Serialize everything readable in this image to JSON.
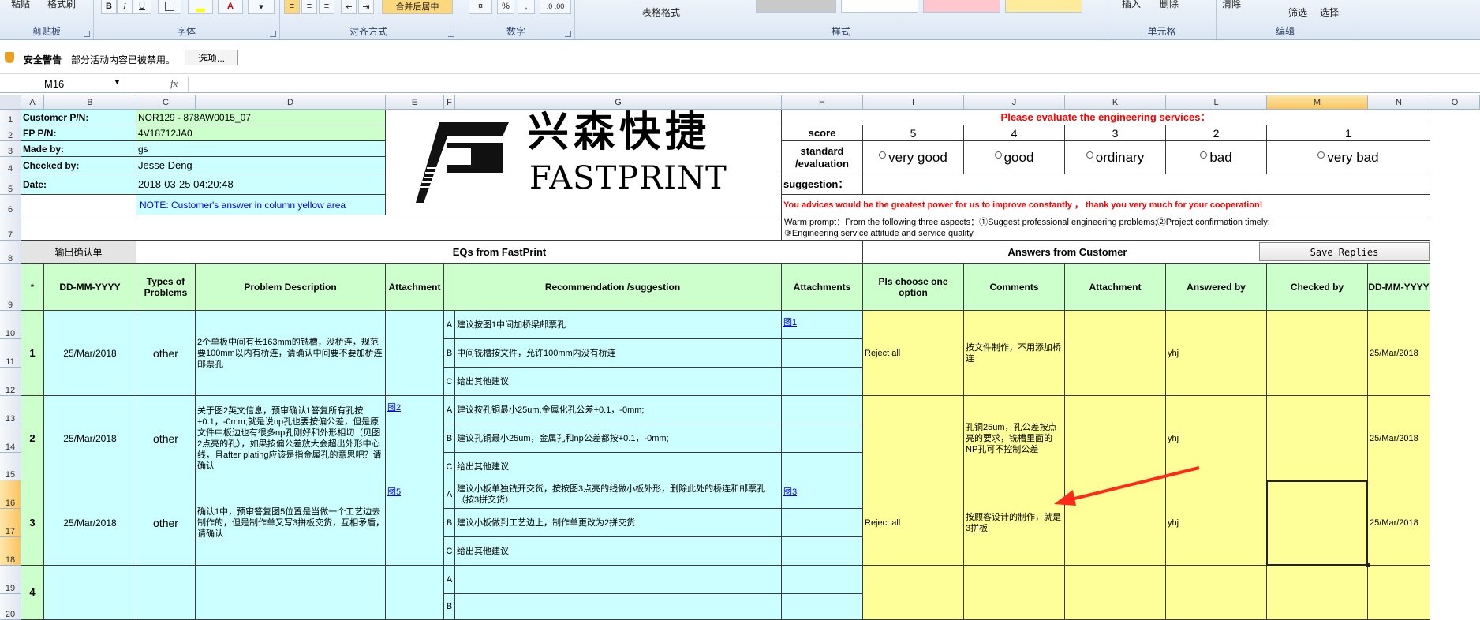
{
  "ribbon": {
    "groups": [
      {
        "label": "剪贴板",
        "btns": [
          "粘贴",
          "格式刷"
        ]
      },
      {
        "label": "字体",
        "btns": [
          "B",
          "I",
          "U",
          "A"
        ]
      },
      {
        "label": "对齐方式",
        "btns": [
          "合并后居中"
        ]
      },
      {
        "label": "数字",
        "btns": [
          "%",
          ","
        ]
      },
      {
        "label": "样式",
        "btns": [
          "表格格式"
        ]
      },
      {
        "label": "单元格",
        "btns": [
          "插入",
          "删除"
        ]
      },
      {
        "label": "编辑",
        "btns": [
          "清除",
          "筛选",
          "选择"
        ]
      }
    ]
  },
  "security": {
    "title": "安全警告",
    "message": "部分活动内容已被禁用。",
    "options_button": "选项..."
  },
  "formula_bar": {
    "name_box": "M16",
    "fx": "fx",
    "content": ""
  },
  "columns": [
    "A",
    "B",
    "C",
    "D",
    "E",
    "F",
    "G",
    "H",
    "I",
    "J",
    "K",
    "L",
    "M",
    "N",
    "O"
  ],
  "rows": [
    "1",
    "2",
    "3",
    "4",
    "5",
    "6",
    "7",
    "8",
    "9",
    "10",
    "11",
    "12",
    "13",
    "14",
    "15",
    "16",
    "17",
    "18",
    "19",
    "20"
  ],
  "header_info": {
    "customer_pn_label": "Customer P/N:",
    "customer_pn": "NOR129 - 878AW0015_07",
    "fp_pn_label": "FP P/N:",
    "fp_pn": "4V18712JA0",
    "made_by_label": "Made by:",
    "made_by": "gs",
    "checked_by_label": "Checked by:",
    "checked_by": "Jesse Deng",
    "date_label": "Date:",
    "date": "2018-03-25 04:20:48",
    "note": "NOTE: Customer's  answer in column yellow area"
  },
  "logo": {
    "cn": "兴森快捷",
    "en": "FASTPRINT"
  },
  "evaluation": {
    "title": "Please evaluate the engineering services：",
    "score_label": "score",
    "scores": [
      "5",
      "4",
      "3",
      "2",
      "1"
    ],
    "standard_label_1": "standard",
    "standard_label_2": "/evaluation",
    "options": [
      "very good",
      "good",
      "ordinary",
      "bad",
      "very bad"
    ],
    "suggestion_label": "suggestion：",
    "advice": "You advices would be the greatest power for us to improve constantly ，  thank you very much for your cooperation!",
    "warm_prompt_1": "Warm prompt：From the following three aspects：①Suggest professional engineering problems;②Project confirmation timely;",
    "warm_prompt_2": "③Engineering service attitude and service quality"
  },
  "sections": {
    "output_confirm": "输出确认单",
    "eqs_title": "EQs from FastPrint",
    "answers_title": "Answers from Customer",
    "save_replies": "Save Replies"
  },
  "table_headers": {
    "star": "*",
    "date": "DD-MM-YYYY",
    "types": "Types of Problems",
    "problem": "Problem Description",
    "attachment": "Attachment",
    "recommendation": "Recommendation /suggestion",
    "attachments": "Attachments",
    "choose": "Pls choose one option",
    "comments": "Comments",
    "cust_attachment": "Attachment",
    "answered_by": "Answered by",
    "checked_by": "Checked by",
    "cust_date": "DD-MM-YYYY"
  },
  "eqs": [
    {
      "no": "1",
      "date": "25/Mar/2018",
      "type": "other",
      "problem": "2个单板中间有长163mm的铣槽，没桥连，规范要100mm以内有桥连，请确认中间要不要加桥连邮票孔",
      "attachment": "",
      "options": [
        {
          "letter": "A",
          "text": "建议按图1中间加桥梁邮票孔",
          "att": "图1"
        },
        {
          "letter": "B",
          "text": "中间铣槽按文件，允许100mm内没有桥连",
          "att": ""
        },
        {
          "letter": "C",
          "text": "给出其他建议",
          "att": ""
        }
      ],
      "choice": "Reject all",
      "comment": "按文件制作，不用添加桥连",
      "answered_by": "yhj",
      "checked_by": "",
      "cdate": "25/Mar/2018"
    },
    {
      "no": "2",
      "date": "25/Mar/2018",
      "type": "other",
      "problem": "关于图2英文信息，预审确认1答复所有孔按+0.1，-0mm;就是说np孔也要按偏公差，但是原文件中板边也有很多np孔刚好和外形相切（见图2点亮的孔），如果按偏公差放大会超出外形中心线，且after plating应该是指金属孔的意思吧？请确认",
      "attachment": "图2",
      "options": [
        {
          "letter": "A",
          "text": "建议按孔铜最小25um,金属化孔公差+0.1，-0mm;",
          "att": ""
        },
        {
          "letter": "B",
          "text": "建议孔铜最小25um，金属孔和np公差都按+0.1，-0mm;",
          "att": ""
        },
        {
          "letter": "C",
          "text": "给出其他建议",
          "att": ""
        }
      ],
      "choice": "",
      "comment": "孔铜25um，孔公差按点亮的要求，铣槽里面的NP孔可不控制公差",
      "answered_by": "yhj",
      "checked_by": "",
      "cdate": "25/Mar/2018"
    },
    {
      "no": "3",
      "date": "25/Mar/2018",
      "type": "other",
      "problem": "确认1中，预审答复图5位置是当做一个工艺边去制作的，但是制作单又写3拼板交货，互相矛盾，请确认",
      "attachment": "图5",
      "options": [
        {
          "letter": "A",
          "text": "建议小板单独铣开交货，按按图3点亮的线做小板外形，删除此处的桥连和邮票孔（按3拼交货）",
          "att": "图3"
        },
        {
          "letter": "B",
          "text": "建议小板做到工艺边上，制作单更改为2拼交货",
          "att": ""
        },
        {
          "letter": "C",
          "text": "给出其他建议",
          "att": ""
        }
      ],
      "choice": "Reject all",
      "comment": "按顾客设计的制作，就是3拼板",
      "answered_by": "yhj",
      "checked_by": "",
      "cdate": "25/Mar/2018"
    },
    {
      "no": "4",
      "date": "",
      "type": "",
      "problem": "",
      "attachment": "",
      "options": [
        {
          "letter": "A",
          "text": "",
          "att": ""
        },
        {
          "letter": "B",
          "text": "",
          "att": ""
        }
      ],
      "choice": "",
      "comment": "",
      "answered_by": "",
      "checked_by": "",
      "cdate": ""
    }
  ]
}
